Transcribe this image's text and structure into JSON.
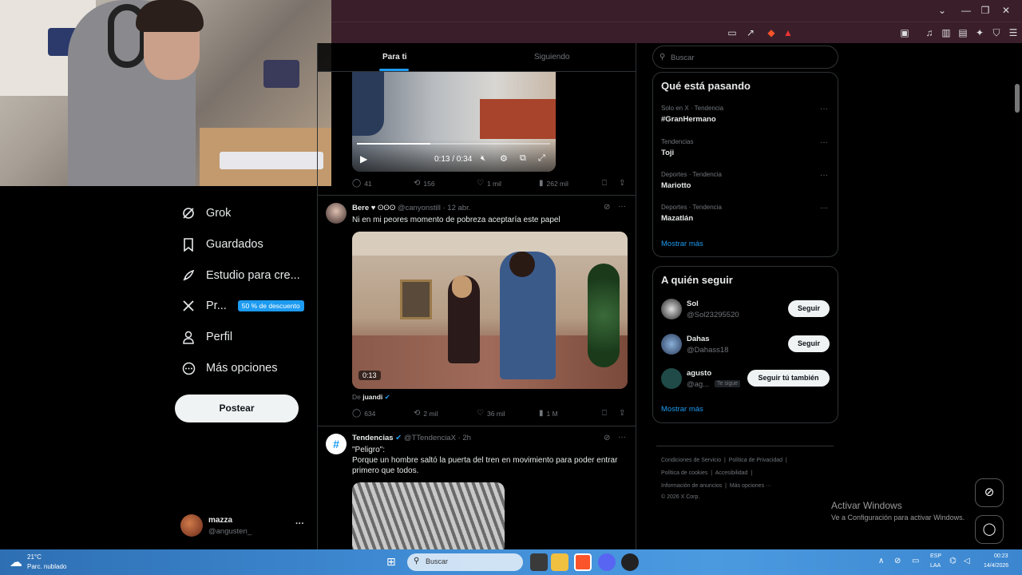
{
  "window": {
    "controls": [
      "⌄",
      "—",
      "❐",
      "✕"
    ]
  },
  "webcam": {
    "desc_hidden": ""
  },
  "sidebar": {
    "items": [
      {
        "label": "Grok",
        "icon": "grok-icon"
      },
      {
        "label": "Guardados",
        "icon": "bookmark-icon"
      },
      {
        "label": "Estudio para cre...",
        "icon": "rocket-icon"
      },
      {
        "label": "Pr...",
        "icon": "x-logo-icon",
        "badge": "50 % de descuento"
      },
      {
        "label": "Perfil",
        "icon": "person-icon"
      },
      {
        "label": "Más opciones",
        "icon": "more-circle-icon"
      }
    ],
    "post_label": "Postear",
    "account": {
      "name": "mazza",
      "handle": "@angusten_",
      "more": "···"
    }
  },
  "feed": {
    "tabs": [
      "Para ti",
      "Siguiendo"
    ],
    "video1": {
      "time": "0:13 / 0:34",
      "progress": 0.38
    },
    "tweet1_actions": {
      "replies": "41",
      "reposts": "156",
      "likes": "1 mil",
      "views": "262 mil"
    },
    "tweet2": {
      "name": "Bere",
      "name_emoji": "♥ ʘʘʘ",
      "handle": "@canyonstill",
      "date": "· 12 abr.",
      "text": "Ni en mi peores momento de pobreza aceptaría este papel",
      "video_time": "0:13",
      "from_prefix": "De",
      "from_name": "juandi",
      "actions": {
        "replies": "634",
        "reposts": "2 mil",
        "likes": "36 mil",
        "views": "1 M"
      }
    },
    "tweet3": {
      "name": "Tendencias",
      "handle": "@TTendenciaX",
      "date": "· 2h",
      "line1": "\"Peligro\":",
      "line2": "Porque un hombre saltó la puerta del tren en movimiento para poder entrar primero que todos."
    }
  },
  "right": {
    "search_placeholder": "Buscar",
    "trending_title": "Qué está pasando",
    "trends": [
      {
        "meta": "Solo en X · Tendencia",
        "name": "#GranHermano"
      },
      {
        "meta": "Tendencias",
        "name": "Toji"
      },
      {
        "meta": "Deportes · Tendencia",
        "name": "Mariotto"
      },
      {
        "meta": "Deportes · Tendencia",
        "name": "Mazatlán"
      }
    ],
    "show_more": "Mostrar más",
    "follow_title": "A quién seguir",
    "follows": [
      {
        "name": "Sol",
        "handle": "@Sol23295520",
        "button": "Seguir"
      },
      {
        "name": "Dahas",
        "handle": "@Dahass18",
        "button": "Seguir"
      },
      {
        "name": "agusto",
        "handle": "@ag...",
        "follows_you": "Te sigue",
        "button": "Seguir tú también"
      }
    ],
    "footer": {
      "l1a": "Condiciones de Servicio",
      "l1b": "Política de Privacidad",
      "l2a": "Política de cookies",
      "l2b": "Accesibilidad",
      "l3a": "Información de anuncios",
      "l3b": "Más opciones ···",
      "copy": "© 2026 X Corp."
    },
    "activate_title": "Activar Windows",
    "activate_sub": "Ve a Configuración para activar Windows."
  },
  "taskbar": {
    "weather_temp": "21°C",
    "weather_desc": "Parc. nublado",
    "search": "Buscar",
    "lang1": "ESP",
    "lang2": "LAA",
    "time": "00:23",
    "date": "14/4/2026"
  },
  "colors": {
    "accent": "#1d9bf0",
    "chrome": "#3a1f2a",
    "bg": "#000000"
  }
}
